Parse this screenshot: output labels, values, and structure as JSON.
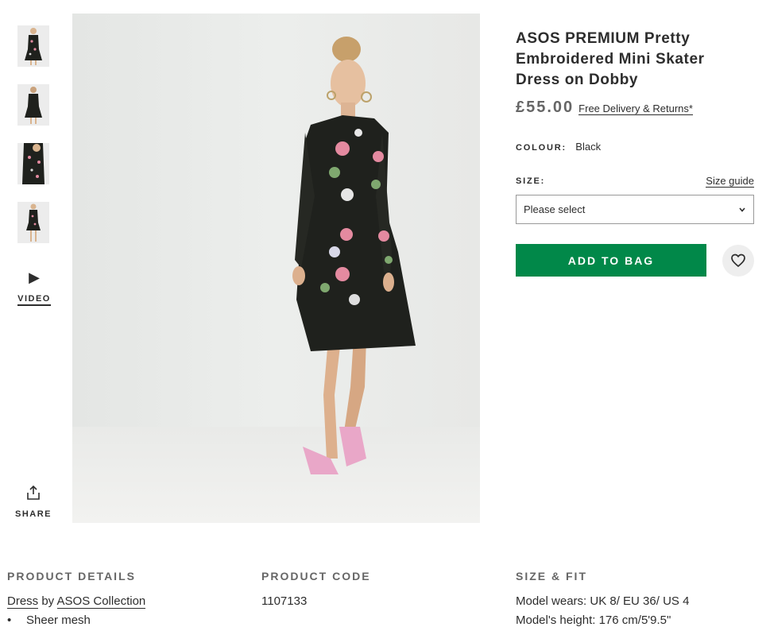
{
  "gallery": {
    "thumbnails": [
      "thumbnail-1",
      "thumbnail-2",
      "thumbnail-3",
      "thumbnail-4"
    ],
    "video_label": "VIDEO",
    "share_label": "SHARE"
  },
  "product": {
    "title": "ASOS PREMIUM Pretty Embroidered Mini Skater Dress on Dobby",
    "price": "£55.00",
    "delivery_link": "Free Delivery & Returns*",
    "colour_label": "COLOUR:",
    "colour_value": "Black",
    "size_label": "SIZE:",
    "size_guide": "Size guide",
    "size_select": "Please select",
    "add_to_bag": "ADD TO BAG"
  },
  "details": {
    "product_details": {
      "heading": "PRODUCT DETAILS",
      "category_link": "Dress",
      "by": "by",
      "brand_link": "ASOS Collection",
      "bullets": [
        "Sheer mesh"
      ]
    },
    "product_code": {
      "heading": "PRODUCT CODE",
      "value": "1107133"
    },
    "size_fit": {
      "heading": "SIZE & FIT",
      "model_wears": "Model wears: UK 8/ EU 36/ US 4",
      "model_height": "Model's height: 176 cm/5'9.5\""
    }
  },
  "colors": {
    "accent_green": "#018849",
    "dress": "#1f211d",
    "flower_pink": "#e48aa0"
  }
}
